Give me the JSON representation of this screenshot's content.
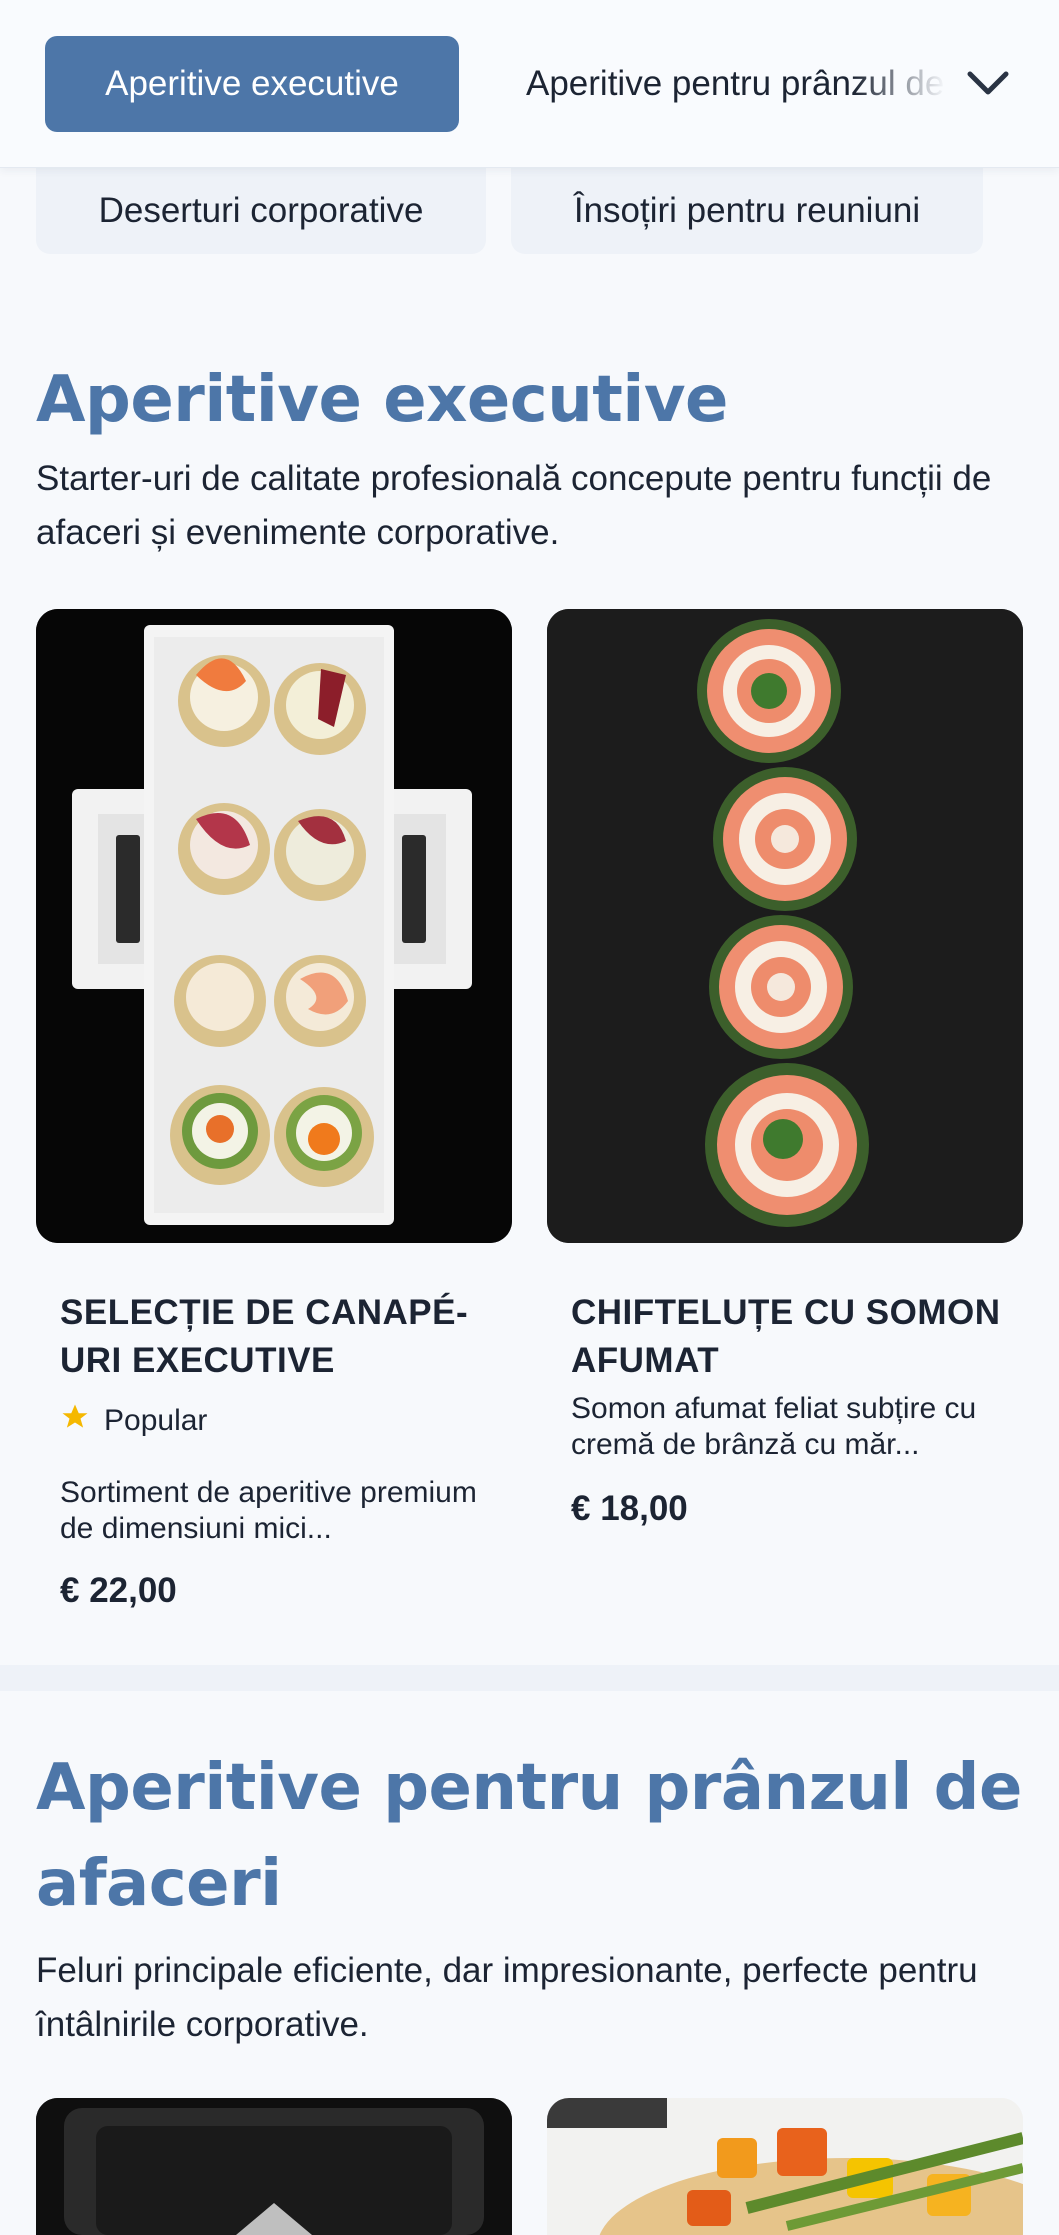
{
  "nav": {
    "active_chip": "Aperitive executive",
    "second_chip": "Aperitive pentru prânzul de afaceri",
    "row2": [
      "Deserturi corporative",
      "Însoțiri pentru reuniuni"
    ]
  },
  "sections": [
    {
      "title": "Aperitive executive",
      "description": "Starter-uri de calitate profesională concepute pentru funcții de afaceri și evenimente corporative.",
      "items": [
        {
          "title": "Selecție de canapé-uri executive",
          "badge": "Popular",
          "description": "Sortiment de aperitive premium de dimensiuni mici...",
          "price": "€ 22,00"
        },
        {
          "title": "Chifteluțe cu somon afumat",
          "description": "Somon afumat feliat subțire cu cremă de brânză cu măr...",
          "price": "€ 18,00"
        }
      ]
    },
    {
      "title": "Aperitive pentru prânzul de afaceri",
      "description": "Feluri principale eficiente, dar impresionante, perfecte pentru întâlnirile corporative."
    }
  ],
  "colors": {
    "accent": "#4d76a8",
    "star": "#f5b800",
    "background": "#f7f9fc"
  },
  "icons": {
    "dropdown": "chevron-down-icon",
    "badge": "star-icon"
  }
}
